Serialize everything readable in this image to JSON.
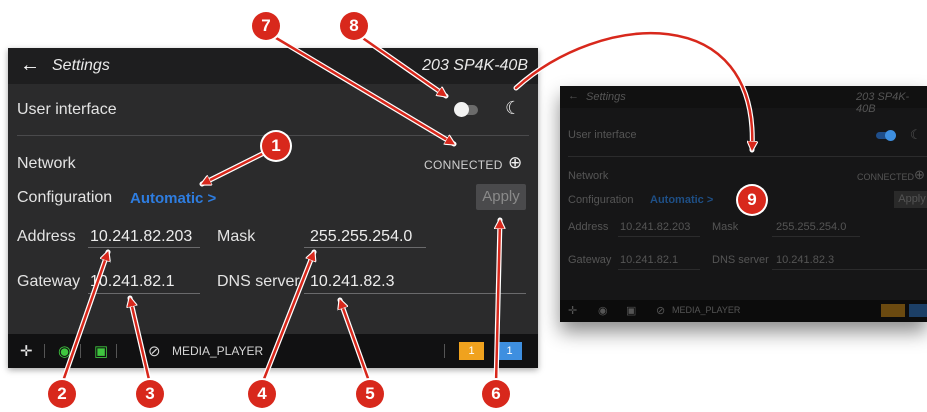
{
  "main": {
    "titlebar": {
      "back_icon": "←",
      "title": "Settings",
      "device": "203 SP4K-40B"
    },
    "user_interface": {
      "label": "User interface",
      "dark_mode_icon": "moon-icon"
    },
    "network": {
      "label": "Network",
      "status": "CONNECTED",
      "status_icon": "globe-icon"
    },
    "configuration": {
      "label": "Configuration",
      "value": "Automatic >",
      "apply_label": "Apply"
    },
    "address": {
      "label": "Address",
      "value": "10.241.82.203"
    },
    "mask": {
      "label": "Mask",
      "value": "255.255.254.0"
    },
    "gateway": {
      "label": "Gateway",
      "value": "10.241.82.1"
    },
    "dns": {
      "label": "DNS server",
      "value": "10.241.82.3"
    },
    "footer": {
      "source_label": "MEDIA_PLAYER",
      "chip1": "1",
      "chip2": "1"
    }
  },
  "preview": {
    "title": "Settings",
    "device": "203 SP4K-40B",
    "user_interface": "User interface",
    "network": "Network",
    "status": "CONNECTED",
    "configuration": "Configuration",
    "config_value": "Automatic >",
    "apply": "Apply",
    "address": "Address",
    "address_value": "10.241.82.203",
    "mask": "Mask",
    "mask_value": "255.255.254.0",
    "gateway": "Gateway",
    "gateway_value": "10.241.82.1",
    "dns": "DNS server",
    "dns_value": "10.241.82.3",
    "source_label": "MEDIA_PLAYER"
  },
  "callouts": [
    "1",
    "2",
    "3",
    "4",
    "5",
    "6",
    "7",
    "8",
    "9"
  ],
  "colors": {
    "badge": "#d8281c",
    "link": "#2e7de0",
    "chip_orange": "#f0a21e",
    "chip_blue": "#3e8fe0"
  }
}
